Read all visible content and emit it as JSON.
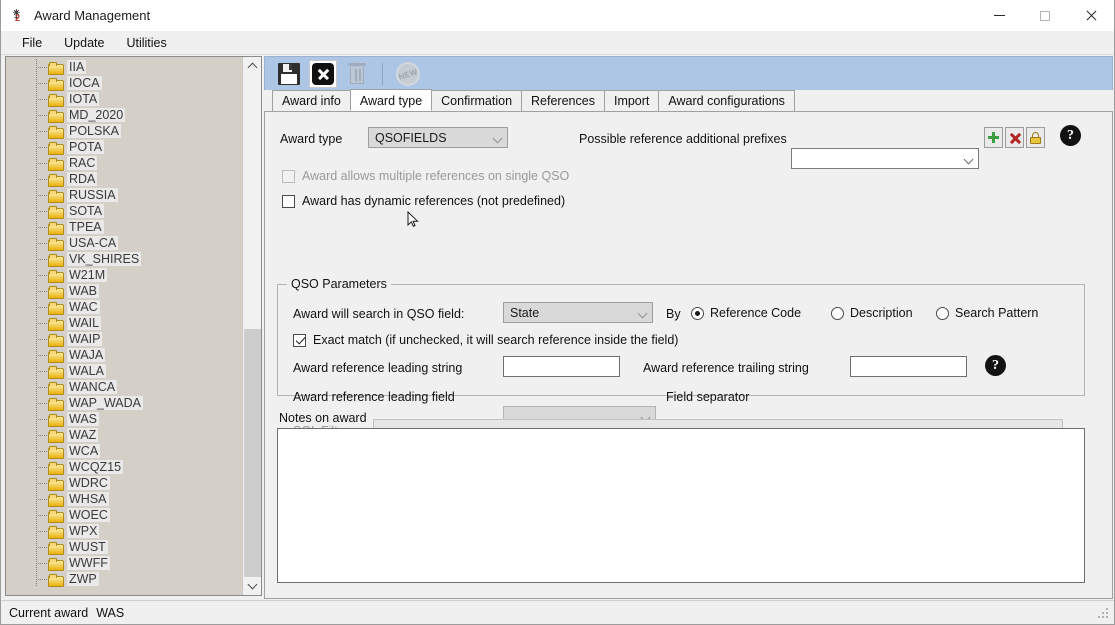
{
  "window": {
    "title": "Award Management",
    "icon": "satellite-icon",
    "controls": {
      "minimize": "minimize-icon",
      "maximize": "maximize-icon",
      "close": "close-icon"
    }
  },
  "menubar": {
    "items": [
      "File",
      "Update",
      "Utilities"
    ]
  },
  "tree": {
    "items": [
      "IIA",
      "IOCA",
      "IOTA",
      "MD_2020",
      "POLSKA",
      "POTA",
      "RAC",
      "RDA",
      "RUSSIA",
      "SOTA",
      "TPEA",
      "USA-CA",
      "VK_SHIRES",
      "W21M",
      "WAB",
      "WAC",
      "WAIL",
      "WAIP",
      "WAJA",
      "WALA",
      "WANCA",
      "WAP_WADA",
      "WAS",
      "WAZ",
      "WCA",
      "WCQZ15",
      "WDRC",
      "WHSA",
      "WOEC",
      "WPX",
      "WUST",
      "WWFF",
      "ZWP"
    ],
    "scroll_up": "chevron-up-icon",
    "scroll_down": "chevron-down-icon"
  },
  "toolbar": {
    "save": "save-icon",
    "close": "close-record-icon",
    "delete": "delete-icon",
    "new": "NEW"
  },
  "tabs": [
    {
      "label": "Award info",
      "active": false
    },
    {
      "label": "Award type",
      "active": true
    },
    {
      "label": "Confirmation",
      "active": false
    },
    {
      "label": "References",
      "active": false
    },
    {
      "label": "Import",
      "active": false
    },
    {
      "label": "Award configurations",
      "active": false
    }
  ],
  "award_type": {
    "label": "Award type",
    "value": "QSOFIELDS",
    "prefixes_label": "Possible reference additional prefixes",
    "prefixes_value": "",
    "add_button": "add-icon",
    "remove_button": "remove-icon",
    "lock_button": "lock-icon",
    "help_button": "?"
  },
  "checkboxes": {
    "multiple_refs": {
      "label": "Award allows multiple references on single QSO",
      "checked": false,
      "disabled": true
    },
    "dynamic_refs": {
      "label": "Award has dynamic references (not predefined)",
      "checked": false,
      "disabled": false
    }
  },
  "qso_parameters": {
    "title": "QSO Parameters",
    "search_field_label": "Award will search in QSO field:",
    "search_field_value": "State",
    "by_label": "By",
    "radios": [
      {
        "label": "Reference Code",
        "selected": true
      },
      {
        "label": "Description",
        "selected": false
      },
      {
        "label": "Search Pattern",
        "selected": false
      }
    ],
    "exact_match": {
      "label": "Exact match (if unchecked, it will search reference inside the field)",
      "checked": true
    },
    "leading_string_label": "Award reference leading string",
    "leading_string_value": "",
    "trailing_string_label": "Award reference trailing string",
    "trailing_string_value": "",
    "leading_field_label": "Award reference leading field",
    "leading_field_value": "",
    "field_separator_label": "Field separator",
    "field_separator_value": "",
    "sql_filters_label": "SQL Filters",
    "sql_filters_value": "",
    "help_button": "?"
  },
  "notes": {
    "label": "Notes on award",
    "value": ""
  },
  "statusbar": {
    "label": "Current award",
    "value": "WAS"
  },
  "colors": {
    "toolbar_bg": "#adc6e5",
    "panel_bg": "#f0f0f0",
    "tree_bg": "#d4d0c8",
    "accent_green": "#3f9e3f",
    "accent_red": "#b32424",
    "accent_yellow": "#e8c33c"
  }
}
